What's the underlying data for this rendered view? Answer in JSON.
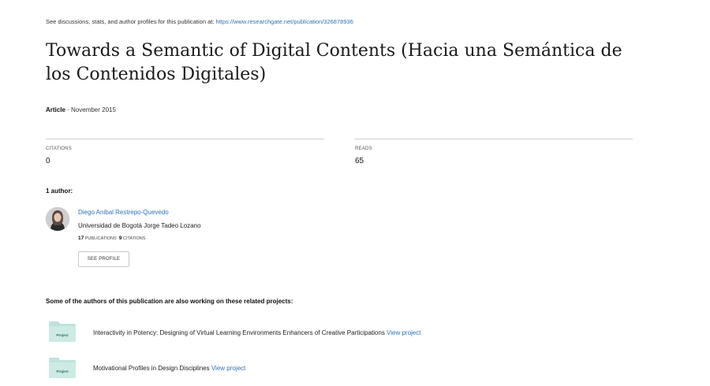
{
  "header": {
    "note_prefix": "See discussions, stats, and author profiles for this publication at: ",
    "note_url": "https://www.researchgate.net/publication/326878936"
  },
  "publication": {
    "title": "Towards a Semantic of Digital Contents (Hacia una Semántica de los Contenidos Digitales)",
    "type": "Article",
    "date_sep": " · ",
    "date": "November 2015"
  },
  "stats": {
    "citations_label": "CITATIONS",
    "citations_value": "0",
    "reads_label": "READS",
    "reads_value": "65"
  },
  "authors": {
    "heading": "1 author:",
    "list": [
      {
        "name": "Diego Anibal Restrepo-Quevedo",
        "institution": "Universidad de Bogotá Jorge Tadeo Lozano",
        "publications_count": "17",
        "publications_label": "PUBLICATIONS",
        "citations_count": "9",
        "citations_label": "CITATIONS",
        "button_label": "SEE PROFILE"
      }
    ]
  },
  "projects": {
    "heading": "Some of the authors of this publication are also working on these related projects:",
    "icon_label": "Project",
    "link_label": "View project",
    "items": [
      {
        "title": "Interactivity in Potency: Designing of Virtual Learning Environments Enhancers of Creative Participations "
      },
      {
        "title": "Motivational Profiles in Design Disciplines "
      }
    ]
  },
  "colors": {
    "link": "#2f74b5",
    "project_icon": "#bfe3dc",
    "project_icon_dark": "#a7d6cd"
  }
}
